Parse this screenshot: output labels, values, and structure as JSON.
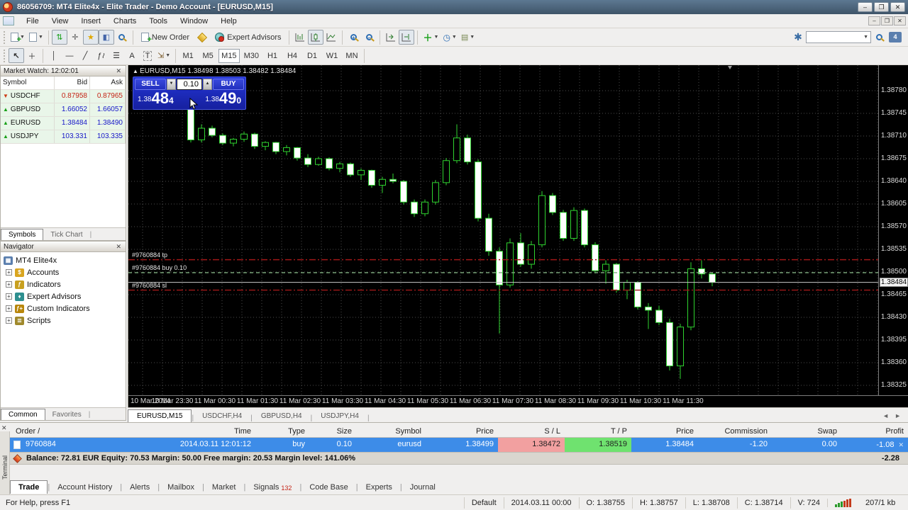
{
  "window": {
    "title": "86056709: MT4 Elite4x - Elite Trader - Demo Account - [EURUSD,M15]"
  },
  "menu": [
    "File",
    "View",
    "Insert",
    "Charts",
    "Tools",
    "Window",
    "Help"
  ],
  "toolbar": {
    "new_order_label": "New Order",
    "expert_advisors_label": "Expert Advisors",
    "timeframes": [
      "M1",
      "M5",
      "M15",
      "M30",
      "H1",
      "H4",
      "D1",
      "W1",
      "MN"
    ],
    "active_timeframe": "M15",
    "text_tool_label": "A",
    "label_tool_label": "T",
    "chat_badge": "4"
  },
  "market_watch": {
    "title": "Market Watch: 12:02:01",
    "columns": [
      "Symbol",
      "Bid",
      "Ask"
    ],
    "rows": [
      {
        "symbol": "USDCHF",
        "bid": "0.87958",
        "ask": "0.87965",
        "direction": "down"
      },
      {
        "symbol": "GBPUSD",
        "bid": "1.66052",
        "ask": "1.66057",
        "direction": "up"
      },
      {
        "symbol": "EURUSD",
        "bid": "1.38484",
        "ask": "1.38490",
        "direction": "up"
      },
      {
        "symbol": "USDJPY",
        "bid": "103.331",
        "ask": "103.335",
        "direction": "up"
      }
    ],
    "tabs": [
      "Symbols",
      "Tick Chart"
    ]
  },
  "navigator": {
    "title": "Navigator",
    "root": "MT4 Elite4x",
    "items": [
      "Accounts",
      "Indicators",
      "Expert Advisors",
      "Custom Indicators",
      "Scripts"
    ],
    "tabs": [
      "Common",
      "Favorites"
    ]
  },
  "chart": {
    "header_symbol": "EURUSD,M15",
    "header_ohlc": "1.38498 1.38503 1.38482 1.38484",
    "one_click": {
      "sell_label": "SELL",
      "buy_label": "BUY",
      "volume": "0.10",
      "sell_prefix": "1.38",
      "sell_main": "48",
      "sell_sup": "4",
      "buy_prefix": "1.38",
      "buy_main": "49",
      "buy_sup": "0"
    },
    "price_axis_ticks": [
      "1.38780",
      "1.38745",
      "1.38710",
      "1.38675",
      "1.38640",
      "1.38605",
      "1.38570",
      "1.38535",
      "1.38500",
      "1.38465",
      "1.38430",
      "1.38395",
      "1.38360",
      "1.38325"
    ],
    "current_price": "1.38484",
    "time_axis": [
      "10 Mar 2014",
      "10 Mar 23:30",
      "11 Mar 00:30",
      "11 Mar 01:30",
      "11 Mar 02:30",
      "11 Mar 03:30",
      "11 Mar 04:30",
      "11 Mar 05:30",
      "11 Mar 06:30",
      "11 Mar 07:30",
      "11 Mar 08:30",
      "11 Mar 09:30",
      "11 Mar 10:30",
      "11 Mar 11:30"
    ],
    "trade_lines": [
      {
        "label": "#9760884 tp",
        "price": 1.38519,
        "kind": "tp"
      },
      {
        "label": "#9760884 buy 0.10",
        "price": 1.38499,
        "kind": "buy"
      },
      {
        "label": "#9760884 sl",
        "price": 1.38472,
        "kind": "sl"
      }
    ],
    "bid_line_price": 1.38484,
    "tabs": [
      "EURUSD,M15",
      "USDCHF,H4",
      "GBPUSD,H4",
      "USDJPY,H4"
    ],
    "active_tab": "EURUSD,M15",
    "colors": {
      "bull_fill": "#000000",
      "bear_fill": "#ffffff",
      "candle_line": "#2fd32f",
      "grid": "#4d4d4d",
      "stop_line": "#a01818",
      "buy_line": "#7fae7f",
      "bid_line": "#c8c8c8"
    },
    "chart_data": {
      "type": "candlestick",
      "symbol": "EURUSD",
      "timeframe": "M15",
      "ylim": [
        1.38325,
        1.3878
      ],
      "candles": [
        [
          1.3876,
          1.38768,
          1.387,
          1.38704
        ],
        [
          1.38704,
          1.38728,
          1.387,
          1.38722
        ],
        [
          1.38722,
          1.38726,
          1.38708,
          1.38711
        ],
        [
          1.38711,
          1.38714,
          1.38696,
          1.38699
        ],
        [
          1.38699,
          1.38707,
          1.38694,
          1.38705
        ],
        [
          1.38705,
          1.38717,
          1.38701,
          1.38713
        ],
        [
          1.38713,
          1.38715,
          1.3869,
          1.38694
        ],
        [
          1.38694,
          1.38702,
          1.38688,
          1.387
        ],
        [
          1.387,
          1.38701,
          1.38682,
          1.38686
        ],
        [
          1.38686,
          1.38696,
          1.3868,
          1.38692
        ],
        [
          1.38692,
          1.38693,
          1.38672,
          1.38676
        ],
        [
          1.38676,
          1.38682,
          1.38662,
          1.38666
        ],
        [
          1.38666,
          1.38678,
          1.38664,
          1.38675
        ],
        [
          1.38675,
          1.38677,
          1.38657,
          1.3866
        ],
        [
          1.3866,
          1.3867,
          1.38654,
          1.38667
        ],
        [
          1.38667,
          1.38669,
          1.38647,
          1.3865
        ],
        [
          1.3865,
          1.3866,
          1.38642,
          1.38657
        ],
        [
          1.38657,
          1.38658,
          1.3863,
          1.38634
        ],
        [
          1.38634,
          1.38647,
          1.38622,
          1.38643
        ],
        [
          1.38643,
          1.38652,
          1.38637,
          1.3864
        ],
        [
          1.3864,
          1.38642,
          1.38604,
          1.38608
        ],
        [
          1.38608,
          1.38612,
          1.38585,
          1.3859
        ],
        [
          1.3859,
          1.38612,
          1.38586,
          1.38608
        ],
        [
          1.38608,
          1.38642,
          1.38604,
          1.38638
        ],
        [
          1.38638,
          1.38676,
          1.38634,
          1.38672
        ],
        [
          1.38672,
          1.38728,
          1.38668,
          1.38707
        ],
        [
          1.38707,
          1.38712,
          1.38666,
          1.3867
        ],
        [
          1.3867,
          1.38674,
          1.38578,
          1.38583
        ],
        [
          1.38583,
          1.3859,
          1.38525,
          1.38532
        ],
        [
          1.38532,
          1.38538,
          1.38405,
          1.3848
        ],
        [
          1.3848,
          1.38552,
          1.38476,
          1.38545
        ],
        [
          1.38545,
          1.3856,
          1.38508,
          1.38512
        ],
        [
          1.38512,
          1.38548,
          1.38505,
          1.38542
        ],
        [
          1.38542,
          1.38625,
          1.38538,
          1.38618
        ],
        [
          1.38618,
          1.38622,
          1.38588,
          1.38592
        ],
        [
          1.38592,
          1.38596,
          1.38548,
          1.38552
        ],
        [
          1.38552,
          1.386,
          1.38548,
          1.38595
        ],
        [
          1.38595,
          1.38598,
          1.38538,
          1.38542
        ],
        [
          1.38542,
          1.38546,
          1.38498,
          1.38502
        ],
        [
          1.38502,
          1.38518,
          1.38482,
          1.38512
        ],
        [
          1.38512,
          1.38514,
          1.38468,
          1.38472
        ],
        [
          1.38472,
          1.38488,
          1.38458,
          1.38484
        ],
        [
          1.38484,
          1.38486,
          1.38442,
          1.38446
        ],
        [
          1.38446,
          1.38452,
          1.38412,
          1.38441
        ],
        [
          1.38441,
          1.38448,
          1.38418,
          1.38422
        ],
        [
          1.38422,
          1.38428,
          1.38348,
          1.38355
        ],
        [
          1.38355,
          1.3842,
          1.38335,
          1.38415
        ],
        [
          1.38415,
          1.38515,
          1.3841,
          1.38505
        ],
        [
          1.38505,
          1.38518,
          1.3849,
          1.38497
        ],
        [
          1.38497,
          1.385,
          1.38478,
          1.38484
        ]
      ]
    }
  },
  "terminal": {
    "side_label": "Terminal",
    "columns": [
      "Order /",
      "Time",
      "Type",
      "Size",
      "Symbol",
      "Price",
      "S / L",
      "T / P",
      "Price",
      "Commission",
      "Swap",
      "Profit"
    ],
    "order": {
      "id": "9760884",
      "time": "2014.03.11 12:01:12",
      "type": "buy",
      "size": "0.10",
      "symbol": "eurusd",
      "price": "1.38499",
      "sl": "1.38472",
      "tp": "1.38519",
      "price2": "1.38484",
      "commission": "-1.20",
      "swap": "0.00",
      "profit": "-1.08"
    },
    "balance_line": "Balance: 72.81 EUR   Equity: 70.53   Margin: 50.00   Free margin: 20.53   Margin level: 141.06%",
    "balance_profit": "-2.28",
    "tabs": [
      {
        "label": "Trade",
        "active": true
      },
      {
        "label": "Account History"
      },
      {
        "label": "Alerts"
      },
      {
        "label": "Mailbox"
      },
      {
        "label": "Market"
      },
      {
        "label": "Signals",
        "badge": "132"
      },
      {
        "label": "Code Base"
      },
      {
        "label": "Experts"
      },
      {
        "label": "Journal"
      }
    ]
  },
  "status_bar": {
    "help": "For Help, press F1",
    "profile": "Default",
    "bar_time": "2014.03.11 00:00",
    "open": "O: 1.38755",
    "high": "H: 1.38757",
    "low": "L: 1.38708",
    "close": "C: 1.38714",
    "volume": "V: 724",
    "traffic": "207/1 kb"
  }
}
